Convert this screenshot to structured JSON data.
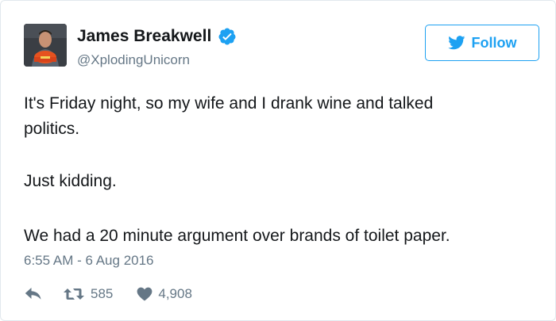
{
  "tweet": {
    "author_name": "James Breakwell",
    "handle": "@XplodingUnicorn",
    "follow_label": "Follow",
    "text_lines": [
      "It's Friday night, so my wife and I drank wine and talked",
      "politics.",
      "Just kidding.",
      "We had a 20 minute argument over brands of toilet paper."
    ],
    "timestamp": "6:55 AM - 6 Aug 2016",
    "retweet_count": "585",
    "like_count": "4,908"
  },
  "icons": {
    "verified": "verified-badge-icon",
    "twitter_bird": "twitter-bird-icon",
    "reply": "reply-icon",
    "retweet": "retweet-icon",
    "like": "heart-icon"
  },
  "colors": {
    "accent": "#1da1f2",
    "muted": "#657786",
    "text": "#14171a",
    "border": "#e1e8ed"
  }
}
